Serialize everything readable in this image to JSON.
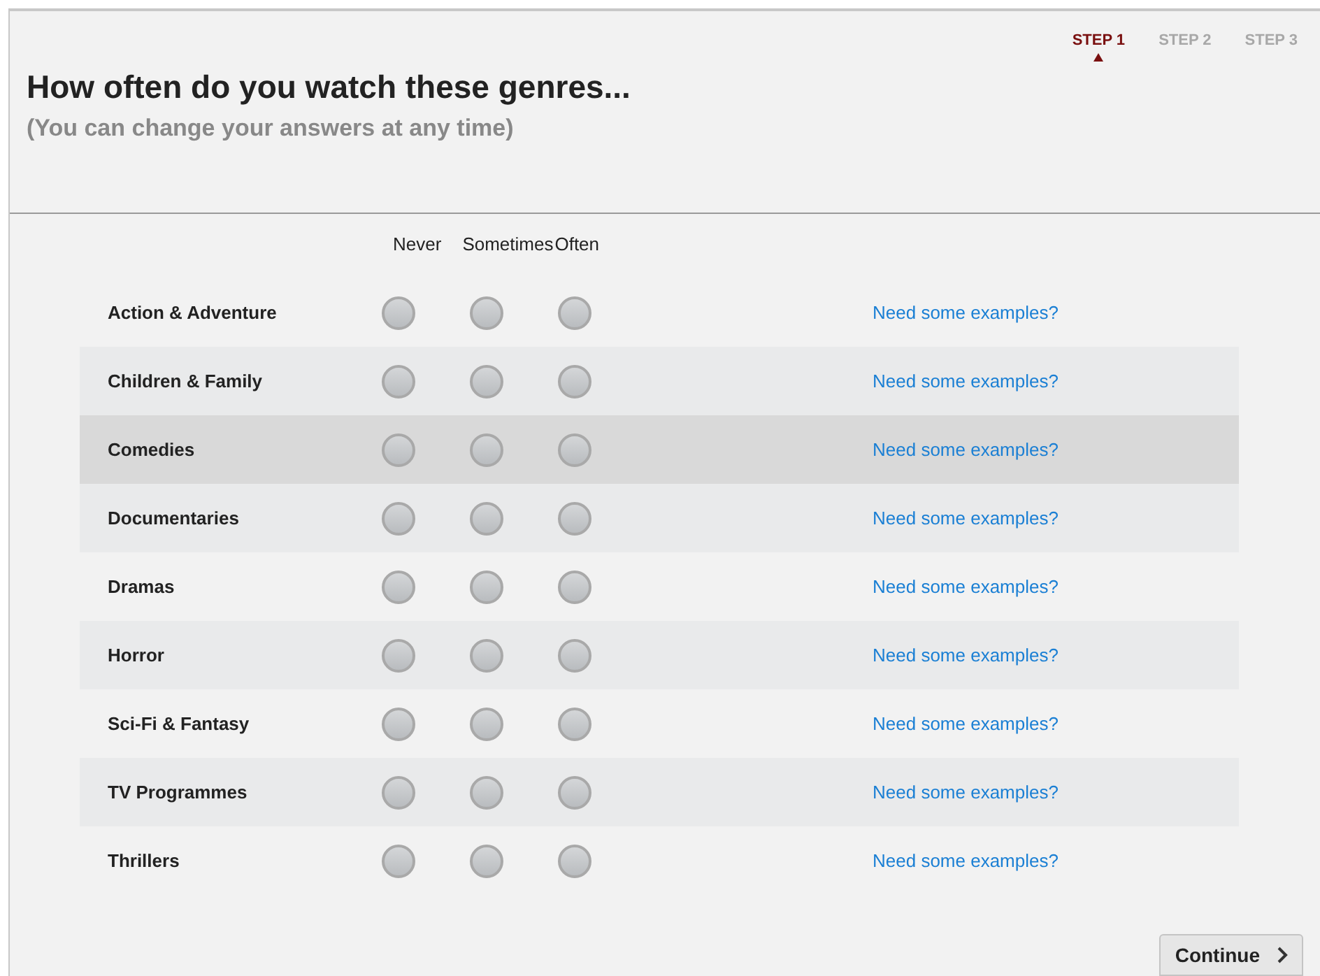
{
  "steps": [
    {
      "label": "STEP 1",
      "selected": true
    },
    {
      "label": "STEP 2",
      "selected": false
    },
    {
      "label": "STEP 3",
      "selected": false
    }
  ],
  "title": "How often do you watch these genres...",
  "subtitle": "(You can change your answers at any time)",
  "columns": [
    "Never",
    "Sometimes",
    "Often"
  ],
  "genres": [
    {
      "name": "Action & Adventure",
      "highlighted": false,
      "options": [
        {
          "selected": false
        },
        {
          "selected": false
        },
        {
          "selected": false
        }
      ],
      "link": "Need some examples?"
    },
    {
      "name": "Children & Family",
      "highlighted": false,
      "options": [
        {
          "selected": false
        },
        {
          "selected": false
        },
        {
          "selected": false
        }
      ],
      "link": "Need some examples?"
    },
    {
      "name": "Comedies",
      "highlighted": true,
      "options": [
        {
          "selected": false
        },
        {
          "selected": false
        },
        {
          "selected": false
        }
      ],
      "link": "Need some examples?"
    },
    {
      "name": "Documentaries",
      "highlighted": false,
      "options": [
        {
          "selected": false
        },
        {
          "selected": false
        },
        {
          "selected": false
        }
      ],
      "link": "Need some examples?"
    },
    {
      "name": "Dramas",
      "highlighted": false,
      "options": [
        {
          "selected": false
        },
        {
          "selected": false
        },
        {
          "selected": false
        }
      ],
      "link": "Need some examples?"
    },
    {
      "name": "Horror",
      "highlighted": false,
      "options": [
        {
          "selected": false
        },
        {
          "selected": false
        },
        {
          "selected": false
        }
      ],
      "link": "Need some examples?"
    },
    {
      "name": "Sci-Fi & Fantasy",
      "highlighted": false,
      "options": [
        {
          "selected": false
        },
        {
          "selected": false
        },
        {
          "selected": false
        }
      ],
      "link": "Need some examples?"
    },
    {
      "name": "TV Programmes",
      "highlighted": false,
      "options": [
        {
          "selected": false
        },
        {
          "selected": false
        },
        {
          "selected": false
        }
      ],
      "link": "Need some examples?"
    },
    {
      "name": "Thrillers",
      "highlighted": false,
      "options": [
        {
          "selected": false
        },
        {
          "selected": false
        },
        {
          "selected": false
        }
      ],
      "link": "Need some examples?"
    }
  ],
  "continue_button": "Continue"
}
